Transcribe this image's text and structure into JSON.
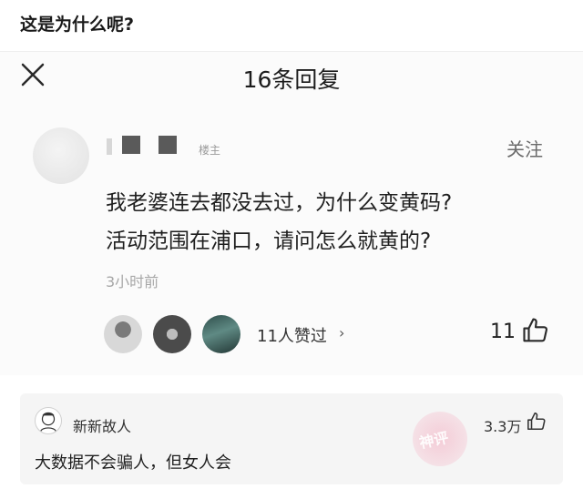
{
  "post": {
    "title": "这是为什么呢?"
  },
  "reply_panel": {
    "title": "16条回复",
    "close_icon": "close-icon"
  },
  "main_comment": {
    "floor_badge": "楼主",
    "follow_label": "关注",
    "lines": [
      "我老婆连去都没去过，为什么变黄码?",
      "活动范围在浦口，请问怎么就黄的?"
    ],
    "timestamp": "3小时前",
    "likers_summary": "11人赞过",
    "likers_chevron": "›",
    "like_count": "11"
  },
  "top_reply": {
    "username": "新新故人",
    "like_count": "3.3万",
    "text": "大数据不会骗人，但女人会"
  },
  "watermark": {
    "text": "神评"
  },
  "colors": {
    "watermark": "#f4aabe",
    "text": "#1f1f1f",
    "muted": "#a7a7a7"
  }
}
